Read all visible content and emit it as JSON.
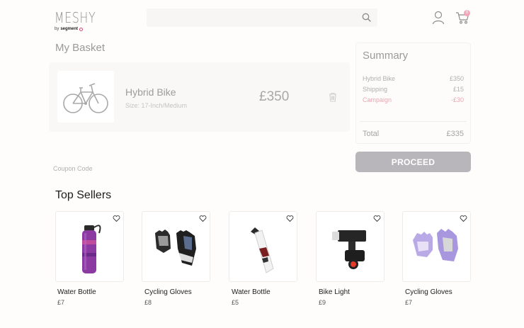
{
  "header": {
    "logo_word": "MESHY",
    "logo_by": "by",
    "logo_brand": "segment",
    "search_placeholder": "",
    "cart_count": "0"
  },
  "basket": {
    "title": "My Basket",
    "item": {
      "name": "Hybrid Bike",
      "size": "Size: 17-Inch/Medium",
      "price": "£350"
    },
    "coupon_placeholder": "Coupon Code"
  },
  "summary": {
    "title": "Summary",
    "rows": [
      {
        "label": "Hybrid Bike",
        "value": "£350"
      },
      {
        "label": "Shipping",
        "value": "£15"
      },
      {
        "label": "Campaign",
        "value": "-£30"
      }
    ],
    "total_label": "Total",
    "total_value": "£335",
    "proceed_label": "PROCEED"
  },
  "top_sellers": {
    "title": "Top Sellers",
    "products": [
      {
        "name": "Water Bottle",
        "price": "£7"
      },
      {
        "name": "Cycling Gloves",
        "price": "£8"
      },
      {
        "name": "Water Bottle",
        "price": "£5"
      },
      {
        "name": "Bike Light",
        "price": "£9"
      },
      {
        "name": "Cycling Gloves",
        "price": "£7"
      }
    ]
  },
  "colors": {
    "accent_pink": "#f2a7b6",
    "proceed_bg": "#b9b6bb",
    "campaign_text": "#e9a7b4"
  }
}
